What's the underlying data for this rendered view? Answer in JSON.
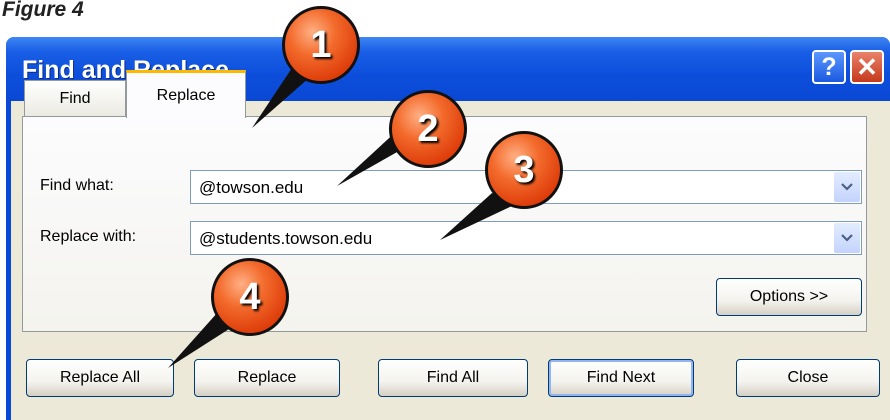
{
  "figure_caption": "Figure 4",
  "window": {
    "title": "Find and Replace",
    "help_glyph": "?",
    "close_glyph": "✕"
  },
  "tabs": [
    {
      "label": "Find",
      "selected": false
    },
    {
      "label": "Replace",
      "selected": true
    }
  ],
  "fields": {
    "find_label": "Find what:",
    "find_value": "@towson.edu",
    "replace_label": "Replace with:",
    "replace_value": "@students.towson.edu"
  },
  "buttons": {
    "options": "Options >>",
    "replace_all": "Replace All",
    "replace": "Replace",
    "find_all": "Find All",
    "find_next": "Find Next",
    "close": "Close"
  },
  "callouts": [
    "1",
    "2",
    "3",
    "4"
  ],
  "colors": {
    "title_bar": "#0a49d8",
    "dialog_bg": "#ece9d8",
    "callout": "#f05a1e",
    "tab_accent": "#ffb800"
  },
  "icons": {
    "help": "question-mark-icon",
    "close": "x-close-icon",
    "dropdown": "chevron-down-icon"
  }
}
